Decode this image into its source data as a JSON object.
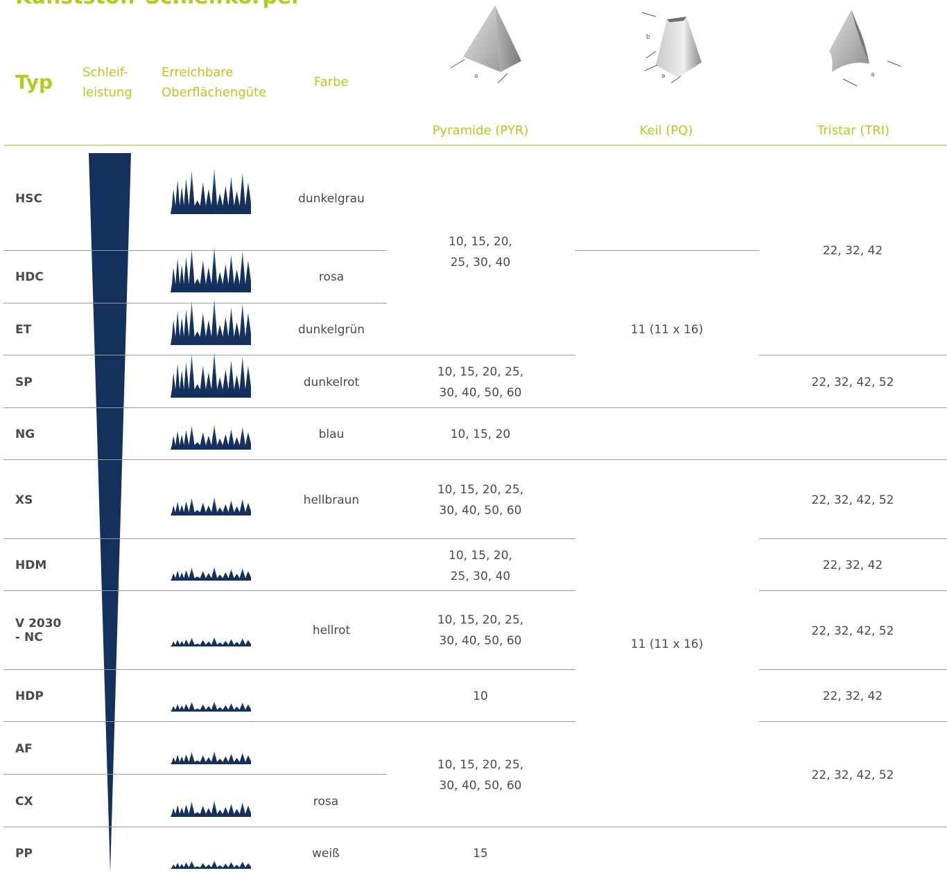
{
  "title": "Kunststoff-Schleifkörper",
  "headers": {
    "typ": "Typ",
    "schleifleistung": [
      "Schleif-",
      "leistung"
    ],
    "oberflaeche": [
      "Erreichbare",
      "Oberflächengüte"
    ],
    "farbe": "Farbe"
  },
  "shapes": [
    {
      "name": "Pyramide (PYR)",
      "icon": "pyramid-icon",
      "dims": [
        "a"
      ]
    },
    {
      "name": "Keil (PQ)",
      "icon": "wedge-icon",
      "dims": [
        "b",
        "a"
      ]
    },
    {
      "name": "Tristar (TRI)",
      "icon": "tristar-icon",
      "dims": [
        "a"
      ]
    }
  ],
  "rows": [
    {
      "typ": "HSC",
      "farbe": "dunkelgrau",
      "roughness": 1.0
    },
    {
      "typ": "HDC",
      "farbe": "rosa",
      "roughness": 1.0
    },
    {
      "typ": "ET",
      "farbe": "dunkelgrün",
      "roughness": 1.0
    },
    {
      "typ": "SP",
      "farbe": "dunkelrot",
      "roughness": 1.0
    },
    {
      "typ": "NG",
      "farbe": "blau",
      "roughness": 0.55
    },
    {
      "typ": "XS",
      "farbe": "hellbraun",
      "roughness": 0.4
    },
    {
      "typ": "HDM",
      "farbe": "",
      "roughness": 0.3
    },
    {
      "typ": "V 2030\n- NC",
      "farbe": "hellrot",
      "roughness": 0.2
    },
    {
      "typ": "HDP",
      "farbe": "",
      "roughness": 0.22
    },
    {
      "typ": "AF",
      "farbe": "",
      "roughness": 0.28
    },
    {
      "typ": "CX",
      "farbe": "rosa",
      "roughness": 0.35
    },
    {
      "typ": "PP",
      "farbe": "weiß",
      "roughness": 0.18
    }
  ],
  "pyramide_values": [
    [
      "10, 15, 20,",
      "25, 30, 40"
    ],
    [
      "10, 15, 20, 25,",
      "30, 40, 50, 60"
    ],
    [
      "10, 15, 20"
    ],
    [
      "10, 15, 20, 25,",
      "30, 40, 50, 60"
    ],
    [
      "10, 15, 20,",
      "25, 30, 40"
    ],
    [
      "10, 15, 20, 25,",
      "30, 40, 50, 60"
    ],
    [
      "10"
    ],
    [
      "10, 15, 20, 25,",
      "30, 40, 50, 60"
    ],
    [
      "15"
    ]
  ],
  "keil_values": [
    "11 (11 x 16)",
    "11 (11 x 16)"
  ],
  "tristar_values": [
    "22, 32, 42",
    "22, 32, 42, 52",
    "22, 32, 42, 52",
    "22, 32, 42",
    "22, 32, 42, 52",
    "22, 32, 42",
    "22, 32, 42, 52"
  ],
  "colors": {
    "accent": "#b3cc1a",
    "navy": "#14305c",
    "text": "#4a4a4a",
    "rule": "#9a9a9a"
  }
}
